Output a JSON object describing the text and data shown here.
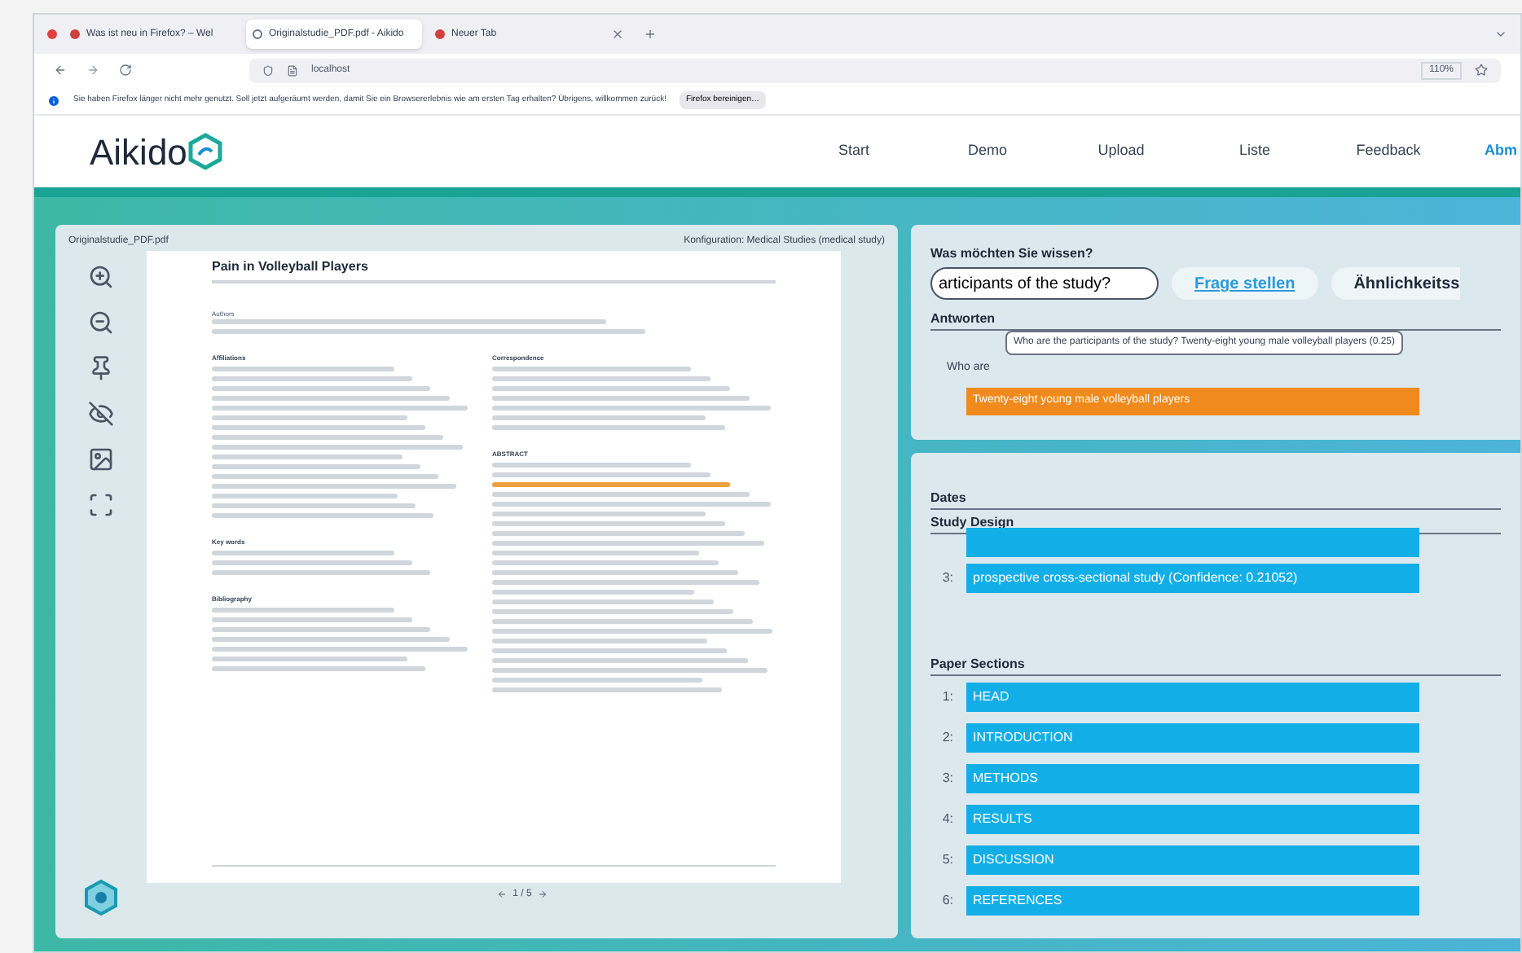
{
  "browser": {
    "tabs": [
      {
        "label": "Was ist neu in Firefox? – Wel",
        "selected": false
      },
      {
        "label": "Originalstudie_PDF.pdf - Aikido",
        "selected": true
      },
      {
        "label": "Neuer Tab",
        "selected": false
      }
    ],
    "url": "localhost",
    "zoom": "110%",
    "notification": {
      "text": "Sie haben Firefox länger nicht mehr genutzt. Soll jetzt aufgeräumt werden, damit Sie ein Browsererlebnis wie am ersten Tag erhalten? Übrigens, willkommen zurück!",
      "button": "Firefox bereinigen…"
    }
  },
  "header": {
    "logo": "Aikido",
    "nav": [
      {
        "label": "Start",
        "kind": "link"
      },
      {
        "label": "Demo",
        "kind": "link"
      },
      {
        "label": "Upload",
        "kind": "link"
      },
      {
        "label": "Liste",
        "kind": "link"
      },
      {
        "label": "Feedback",
        "kind": "link"
      },
      {
        "label": "Abm",
        "kind": "action"
      }
    ]
  },
  "viewer": {
    "file": "Originalstudie_PDF.pdf",
    "config": "Konfiguration: Medical Studies (medical study)",
    "page": {
      "title": "Pain in Volleyball Players",
      "left_headings": [
        "Authors",
        "Affiliations",
        "Key words",
        "Bibliography"
      ],
      "right_headings": [
        "Correspondence",
        "ABSTRACT"
      ]
    },
    "pager": "1 / 5"
  },
  "question": {
    "label": "Was möchten Sie wissen?",
    "value": "articipants of the study?",
    "ask": "Frage stellen",
    "similar": "Ähnlichkeitss",
    "answers_label": "Antworten",
    "answer_prefix": "Who are",
    "tooltip": "Who are the participants of the study?  Twenty-eight young male volleyball players (0.25)",
    "answer": "Twenty-eight young male volleyball players"
  },
  "results": {
    "dates_label": "Dates",
    "design_label": "Study Design",
    "design": [
      {
        "kind": "cut"
      },
      {
        "kind": "entry",
        "number": "3:",
        "text": "prospective cross-sectional study (Confidence: 0.21052)"
      }
    ],
    "sections_label": "Paper Sections",
    "sections": [
      {
        "kind": "entry",
        "number": "1:",
        "text": "HEAD"
      },
      {
        "kind": "entry",
        "number": "2:",
        "text": "INTRODUCTION"
      },
      {
        "kind": "entry",
        "number": "3:",
        "text": "METHODS"
      },
      {
        "kind": "entry",
        "number": "4:",
        "text": "RESULTS"
      },
      {
        "kind": "entry",
        "number": "5:",
        "text": "DISCUSSION"
      },
      {
        "kind": "entry",
        "number": "6:",
        "text": "REFERENCES"
      }
    ]
  }
}
